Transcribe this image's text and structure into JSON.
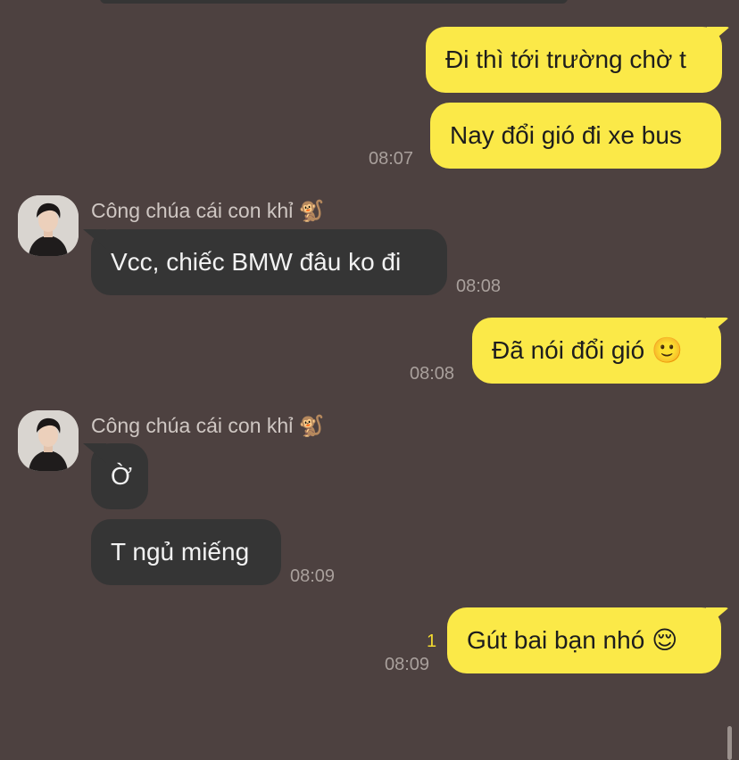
{
  "messages": [
    {
      "text": "Đi thì tới trường chờ t"
    },
    {
      "text": "Nay đổi gió đi xe bus",
      "time": "08:07"
    },
    {
      "sender": "Công chúa cái con khỉ",
      "sender_emoji": "🐒",
      "text": "Vcc, chiếc BMW đâu ko đi",
      "time": "08:08"
    },
    {
      "text": "Đã nói đổi gió",
      "emoji": "🙂",
      "time": "08:08"
    },
    {
      "sender": "Công chúa cái con khỉ",
      "sender_emoji": "🐒",
      "text": "Ờ"
    },
    {
      "text": "T ngủ miếng",
      "time": "08:09"
    },
    {
      "text": "Gút bai bạn nhó",
      "emoji": "😌",
      "time": "08:09",
      "unread": "1"
    }
  ],
  "colors": {
    "background": "#4d4140",
    "outgoing_bubble": "#fbe948",
    "incoming_bubble": "#353535",
    "unread_count": "#f3da2f"
  }
}
